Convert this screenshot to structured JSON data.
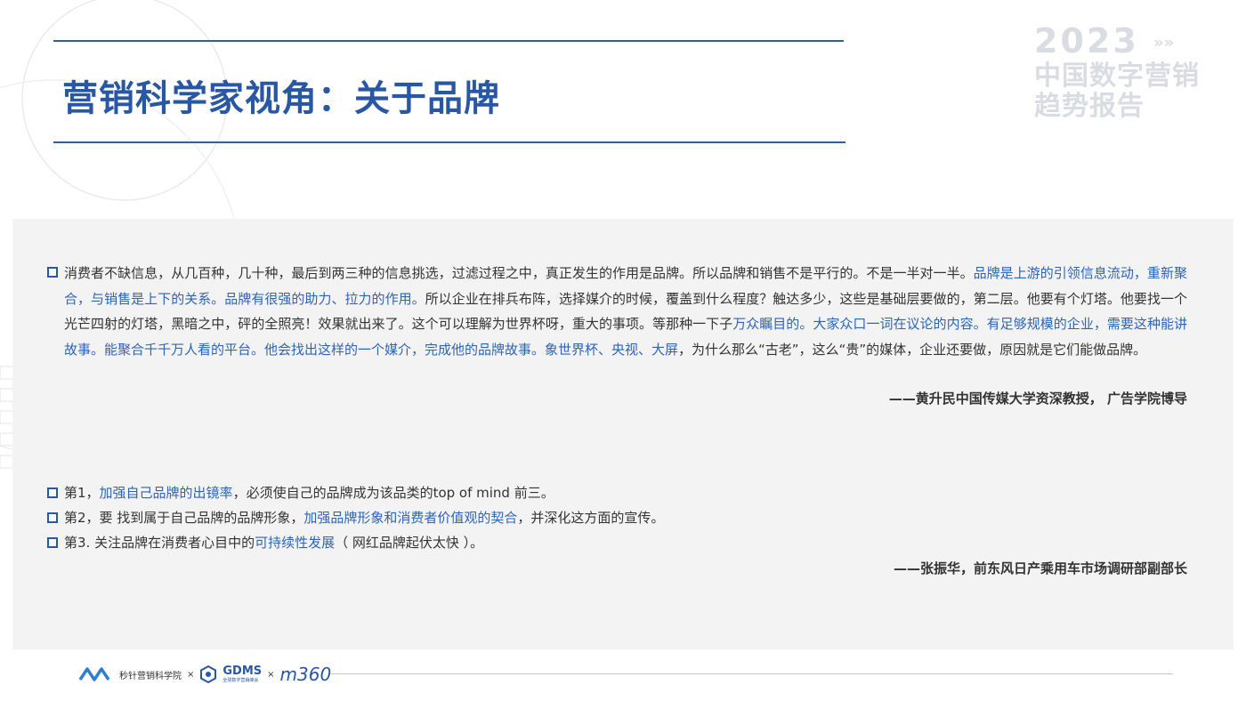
{
  "header": {
    "title": "营销科学家视角：关于品牌"
  },
  "brand_mark": {
    "year": "2023",
    "arrows": "»»",
    "line1": "中国数字营销",
    "line2": "趋势报告"
  },
  "quote1": {
    "segments": [
      {
        "text": "消费者不缺信息，从几百种，几十种，最后到两三种的信息挑选，过滤过程之中，真正发生的作用是品牌。所以品牌和销售不是平行的。不是一半对一半。",
        "hl": false
      },
      {
        "text": "品牌是上游的引领信息流动，重新聚合，与销售是上下的关系。品牌有很强的助力、拉力的作用。",
        "hl": true
      },
      {
        "text": "所以企业在排兵布阵，选择媒介的时候，覆盖到什么程度？触达多少，这些是基础层要做的，第二层。他要有个灯塔。他要找一个光芒四射的灯塔，黑暗之中，砰的全照亮！效果就出来了。这个可以理解为世界杯呀，重大的事项。等那种一下子",
        "hl": false
      },
      {
        "text": "万众瞩目的。大家众口一词在议论的内容。有足够规模的企业，需要这种能讲故事。能聚合千千万人看的平台。他会找出这样的一个媒介，完成他的品牌故事。象世界杯、央视、大屏",
        "hl": true
      },
      {
        "text": "，为什么那么“古老”，这么“贵”的媒体，企业还要做，原因就是它们能做品牌。",
        "hl": false
      }
    ],
    "attribution": "——黄升民中国传媒大学资深教授， 广告学院博导"
  },
  "quote2": {
    "items": [
      {
        "pre": "第1，",
        "hl": "加强自己品牌的出镜率",
        "post": "，必须使自己的品牌成为该品类的top of mind 前三。"
      },
      {
        "pre": "第2，要 找到属于自己品牌的品牌形象，",
        "hl": "加强品牌形象和消费者价值观的契合",
        "post": "，并深化这方面的宣传。"
      },
      {
        "pre": "第3. 关注品牌在消费者心目中的",
        "hl": "可持续性发展",
        "post": "（ 网红品牌起伏太快 ）。"
      }
    ],
    "attribution": "——张振华，前东风日产乘用车市场调研部副部长"
  },
  "footer": {
    "logo1": "秒针营销科学院",
    "times1": "×",
    "logo2": "GDMS",
    "logo2_sub": "全球数字营销峰会",
    "times2": "×",
    "logo3": "m360"
  },
  "colors": {
    "accent": "#2857a4",
    "highlight": "#2e64b7",
    "panel": "#f3f3f3"
  }
}
